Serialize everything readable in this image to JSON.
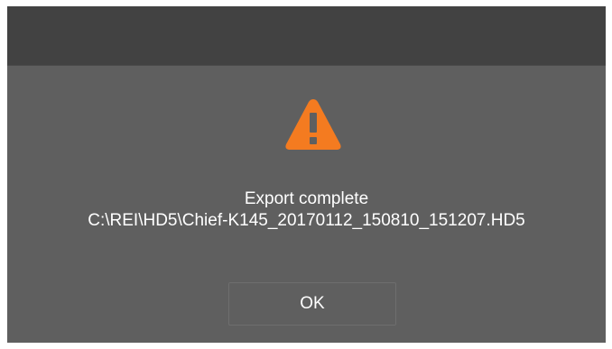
{
  "dialog": {
    "icon": "warning-icon",
    "accent_color": "#f47b20",
    "message_line1": "Export complete",
    "message_line2": "C:\\REI\\HD5\\Chief-K145_20170112_150810_151207.HD5",
    "ok_label": "OK"
  }
}
